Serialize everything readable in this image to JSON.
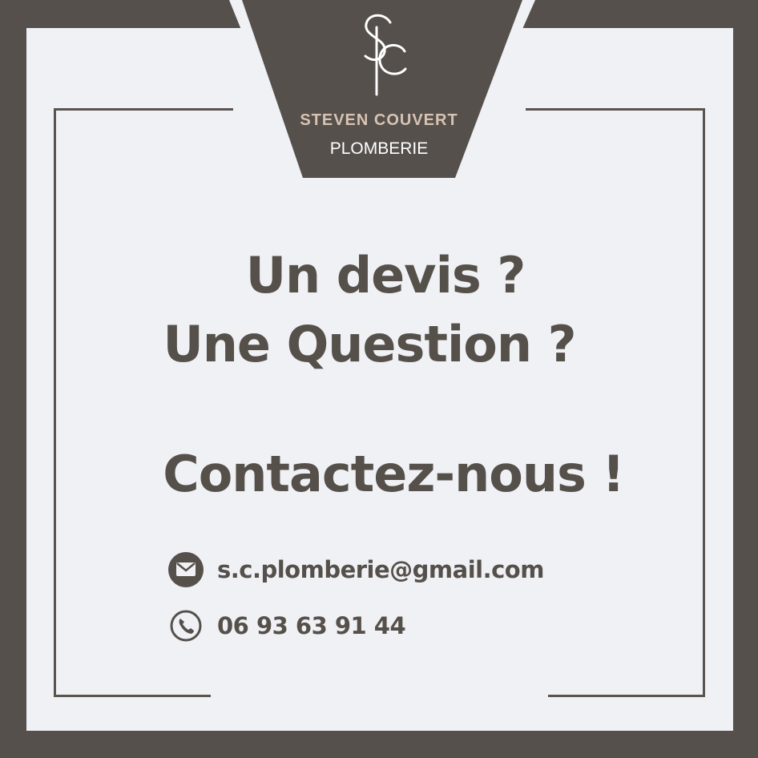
{
  "brand": {
    "monogram": "SC",
    "name": "STEVEN COUVERT",
    "tagline": "PLOMBERIE"
  },
  "headline": {
    "line1": "Un devis ?",
    "line2": "Une Question ?",
    "line3": "Contactez-nous !"
  },
  "contact": {
    "email": "s.c.plomberie@gmail.com",
    "phone": "06 93 63 91 44",
    "email_icon": "envelope-icon",
    "phone_icon": "phone-icon"
  },
  "colors": {
    "dark": "#55504c",
    "panel": "#f0f1f5",
    "accent": "#d8c3b3"
  }
}
